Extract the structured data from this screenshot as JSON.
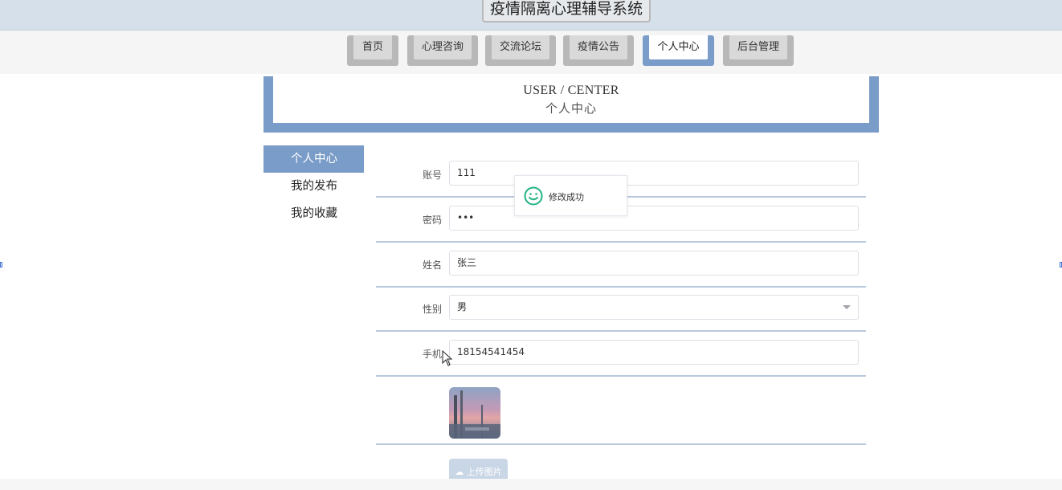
{
  "header": {
    "title": "疫情隔离心理辅导系统"
  },
  "nav": {
    "items": [
      {
        "label": "首页"
      },
      {
        "label": "心理咨询"
      },
      {
        "label": "交流论坛"
      },
      {
        "label": "疫情公告"
      },
      {
        "label": "个人中心",
        "active": true
      },
      {
        "label": "后台管理"
      }
    ]
  },
  "banner": {
    "en": "USER / CENTER",
    "cn": "个人中心"
  },
  "sidebar": {
    "items": [
      {
        "label": "个人中心",
        "active": true
      },
      {
        "label": "我的发布"
      },
      {
        "label": "我的收藏"
      }
    ]
  },
  "form": {
    "account": {
      "label": "账号",
      "value": "111"
    },
    "password": {
      "label": "密码",
      "value": "•••"
    },
    "name": {
      "label": "姓名",
      "value": "张三"
    },
    "gender": {
      "label": "性别",
      "value": "男"
    },
    "phone": {
      "label": "手机",
      "value": "18154541454"
    },
    "upload_label": "上传图片"
  },
  "toast": {
    "message": "修改成功",
    "icon": "smile-icon"
  },
  "colors": {
    "accent": "#7a9cc8",
    "success": "#21b382",
    "topbar": "#d6e0ea"
  }
}
